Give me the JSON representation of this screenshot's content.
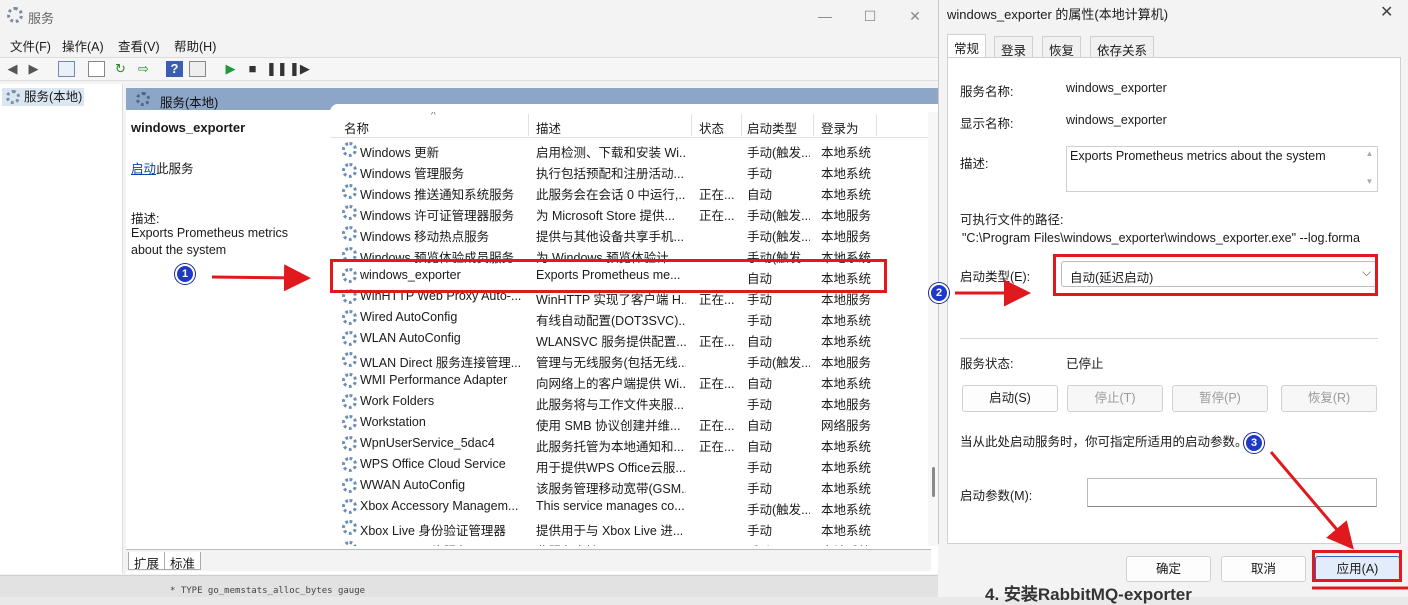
{
  "services_window": {
    "title": "服务",
    "controls": [
      "—",
      "☐",
      "✕"
    ],
    "menu": [
      "文件(F)",
      "操作(A)",
      "查看(V)",
      "帮助(H)"
    ],
    "tree_item": "服务(本地)",
    "pane_header": "服务(本地)",
    "selected_service": {
      "name": "windows_exporter",
      "start_link": "启动",
      "start_suffix": "此服务",
      "desc_label": "描述:",
      "desc_text": "Exports Prometheus metrics about the system"
    },
    "columns": [
      "名称",
      "描述",
      "状态",
      "启动类型",
      "登录为"
    ],
    "rows": [
      [
        "Windows 更新",
        "启用检测、下载和安装 Wi...",
        "",
        "手动(触发...",
        "本地系统"
      ],
      [
        "Windows 管理服务",
        "执行包括预配和注册活动...",
        "",
        "手动",
        "本地系统"
      ],
      [
        "Windows 推送通知系统服务",
        "此服务会在会话 0 中运行,...",
        "正在...",
        "自动",
        "本地系统"
      ],
      [
        "Windows 许可证管理器服务",
        "为 Microsoft Store 提供...",
        "正在...",
        "手动(触发...",
        "本地服务"
      ],
      [
        "Windows 移动热点服务",
        "提供与其他设备共享手机...",
        "",
        "手动(触发...",
        "本地服务"
      ],
      [
        "Windows 预览体验成员服务",
        "为 Windows 预览体验计...",
        "",
        "手动(触发...",
        "本地系统"
      ],
      [
        "windows_exporter",
        "Exports Prometheus me...",
        "",
        "自动",
        "本地系统"
      ],
      [
        "WinHTTP Web Proxy Auto-...",
        "WinHTTP 实现了客户端 H...",
        "正在...",
        "手动",
        "本地服务"
      ],
      [
        "Wired AutoConfig",
        "有线自动配置(DOT3SVC)...",
        "",
        "手动",
        "本地系统"
      ],
      [
        "WLAN AutoConfig",
        "WLANSVC 服务提供配置...",
        "正在...",
        "自动",
        "本地系统"
      ],
      [
        "WLAN Direct 服务连接管理...",
        "管理与无线服务(包括无线...",
        "",
        "手动(触发...",
        "本地服务"
      ],
      [
        "WMI Performance Adapter",
        "向网络上的客户端提供 Wi...",
        "正在...",
        "自动",
        "本地系统"
      ],
      [
        "Work Folders",
        "此服务将与工作文件夹服...",
        "",
        "手动",
        "本地服务"
      ],
      [
        "Workstation",
        "使用 SMB 协议创建并维...",
        "正在...",
        "自动",
        "网络服务"
      ],
      [
        "WpnUserService_5dac4",
        "此服务托管为本地通知和...",
        "正在...",
        "自动",
        "本地系统"
      ],
      [
        "WPS Office Cloud Service",
        "用于提供WPS Office云服...",
        "",
        "手动",
        "本地系统"
      ],
      [
        "WWAN AutoConfig",
        "该服务管理移动宽带(GSM...",
        "",
        "手动",
        "本地系统"
      ],
      [
        "Xbox Accessory Managem...",
        "This service manages co...",
        "",
        "手动(触发...",
        "本地系统"
      ],
      [
        "Xbox Live 身份验证管理器",
        "提供用于与 Xbox Live 进...",
        "",
        "手动",
        "本地系统"
      ],
      [
        "Xbox Live 网络服务",
        "此服务支持 Windows.Net...",
        "",
        "手动",
        "本地系统"
      ]
    ],
    "bottom_tabs": [
      "扩展",
      "标准"
    ],
    "bottom_text": "* TYPE go_memstats_alloc_bytes gauge"
  },
  "dialog": {
    "title": "windows_exporter 的属性(本地计算机)",
    "close": "✕",
    "tabs": [
      "常规",
      "登录",
      "恢复",
      "依存关系"
    ],
    "service_name_label": "服务名称:",
    "service_name": "windows_exporter",
    "display_name_label": "显示名称:",
    "display_name": "windows_exporter",
    "desc_label": "描述:",
    "desc": "Exports Prometheus metrics about the system",
    "path_label": "可执行文件的路径:",
    "path": "\"C:\\Program Files\\windows_exporter\\windows_exporter.exe\" --log.forma",
    "startup_label": "启动类型(E):",
    "startup_value": "自动(延迟启动)",
    "status_label": "服务状态:",
    "status_value": "已停止",
    "buttons": [
      "启动(S)",
      "停止(T)",
      "暂停(P)",
      "恢复(R)"
    ],
    "hint": "当从此处启动服务时，你可指定所适用的启动参数。",
    "param_label": "启动参数(M):",
    "footer": [
      "确定",
      "取消",
      "应用(A)"
    ]
  },
  "annotations": {
    "badges": [
      "1",
      "2",
      "3"
    ],
    "color": "#e0191e"
  },
  "background_text": "4. 安装RabbitMQ-exporter"
}
